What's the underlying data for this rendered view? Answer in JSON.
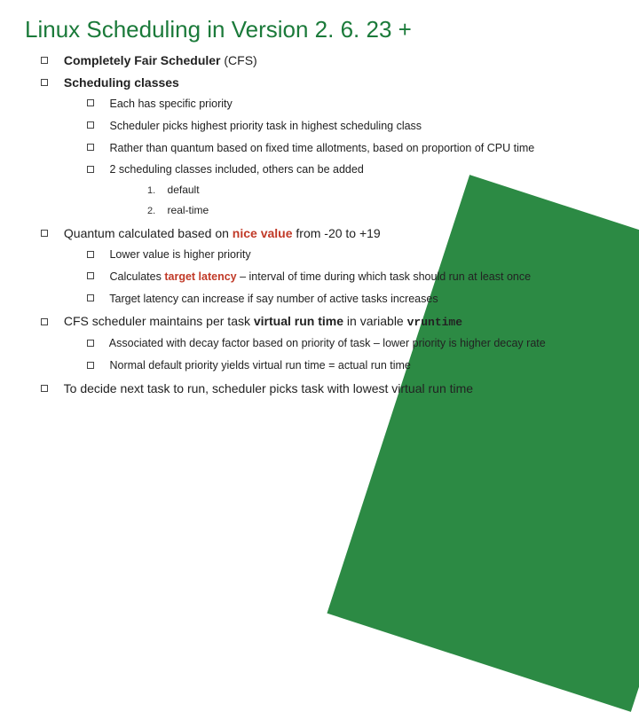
{
  "title": "Linux Scheduling in Version 2. 6. 23 +",
  "l0": {
    "i1a": "Completely Fair Scheduler",
    "i1b": "(CFS)",
    "i2": "Scheduling classes"
  },
  "l1a": {
    "i1": "Each has specific priority",
    "i2": "Scheduler picks highest priority task in highest scheduling class",
    "i3": "Rather than quantum based on fixed time allotments, based on proportion of CPU time",
    "i4": "2 scheduling classes included, others can be added"
  },
  "ol": {
    "n1": "1.",
    "t1": "default",
    "n2": "2.",
    "t2": "real-time"
  },
  "l0b": {
    "i3a": "Quantum calculated based on",
    "i3b": "nice value",
    "i3c": "from -20 to +19"
  },
  "l1b": {
    "i1": "Lower value is higher priority",
    "i2a": "Calculates",
    "i2b": "target latency",
    "i2c": "– interval of time during which task should run at least once",
    "i3": "Target latency can increase if say number of active tasks increases"
  },
  "l0c": {
    "i4a": "CFS scheduler maintains per task",
    "i4b": "virtual run time",
    "i4c": "in variable",
    "i4d": "vruntime"
  },
  "l1c": {
    "i1": "Associated with decay factor based on priority of task – lower priority is higher decay rate",
    "i2": "Normal default priority yields virtual run time = actual run time"
  },
  "l0d": {
    "i5": "To decide next task to run, scheduler picks task with lowest virtual run time"
  }
}
